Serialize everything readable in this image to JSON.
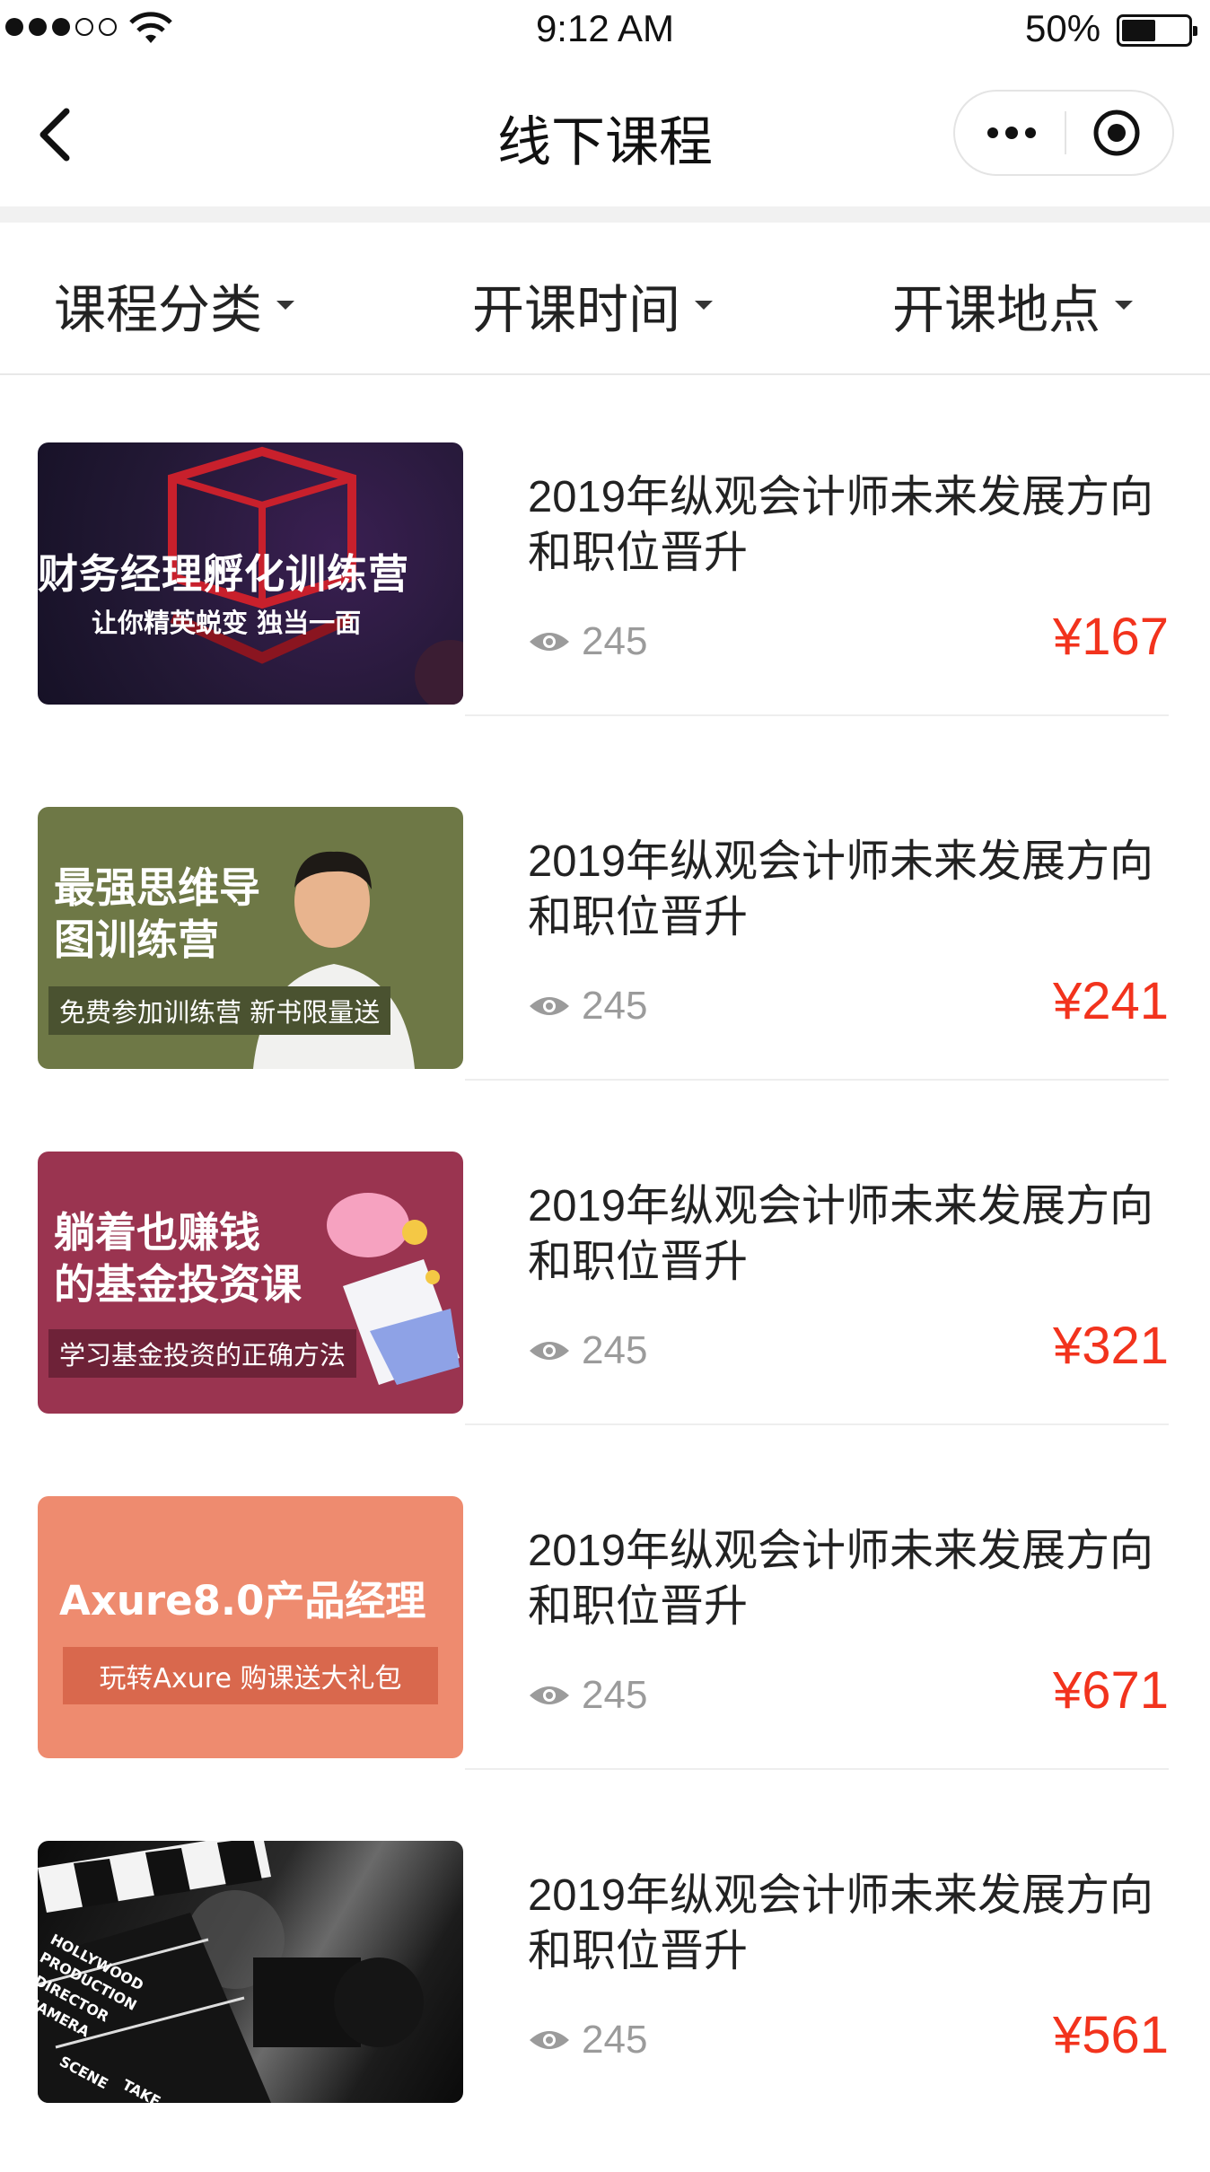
{
  "status_bar": {
    "time": "9:12 AM",
    "battery": "50%"
  },
  "nav": {
    "title": "线下课程"
  },
  "filters": [
    {
      "label": "课程分类"
    },
    {
      "label": "开课时间"
    },
    {
      "label": "开课地点"
    }
  ],
  "courses": [
    {
      "title": "2019年纵观会计师未来发展方向和职位晋升",
      "views": "245",
      "price": "¥167",
      "thumb": {
        "headline": "财务经理孵化训练营",
        "sub": "让你精英蜕变 独当一面"
      }
    },
    {
      "title": "2019年纵观会计师未来发展方向和职位晋升",
      "views": "245",
      "price": "¥241",
      "thumb": {
        "headline_1": "最强思维导",
        "headline_2": "图训练营",
        "sub": "免费参加训练营 新书限量送"
      }
    },
    {
      "title": "2019年纵观会计师未来发展方向和职位晋升",
      "views": "245",
      "price": "¥321",
      "thumb": {
        "headline_1": "躺着也赚钱",
        "headline_2": "的基金投资课",
        "sub": "学习基金投资的正确方法"
      }
    },
    {
      "title": "2019年纵观会计师未来发展方向和职位晋升",
      "views": "245",
      "price": "¥671",
      "thumb": {
        "headline": "Axure8.0产品经理",
        "sub": "玩转Axure 购课送大礼包"
      }
    },
    {
      "title": "2019年纵观会计师未来发展方向和职位晋升",
      "views": "245",
      "price": "¥561",
      "thumb": {
        "clapper_1": "HOLLYWOOD",
        "clapper_2": "PRODUCTION",
        "clapper_3": "DIRECTOR",
        "clapper_4": "CAMERA",
        "clapper_5": "SCENE",
        "clapper_6": "TAKE"
      }
    }
  ],
  "colors": {
    "price": "#f2331d",
    "muted": "#9b9b9b"
  }
}
